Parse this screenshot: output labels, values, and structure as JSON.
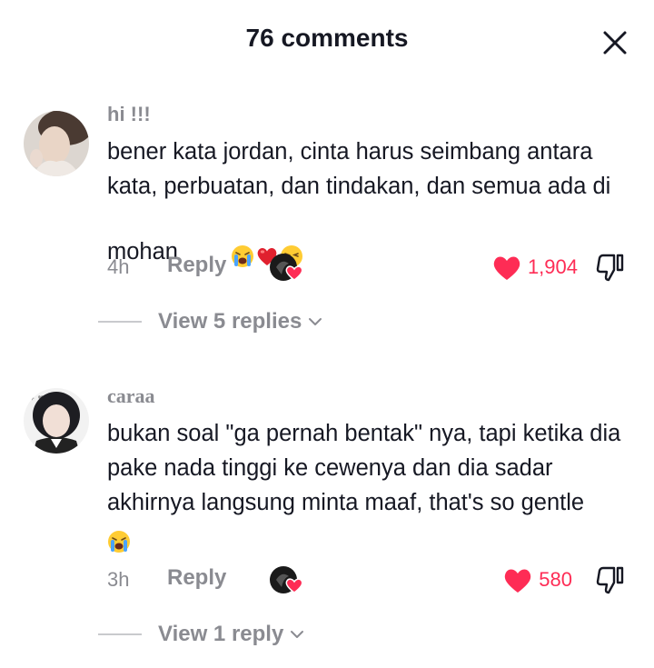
{
  "header": {
    "title": "76 comments",
    "close_icon": "close-icon"
  },
  "comments": [
    {
      "username": "hi !!!",
      "text": "bener kata jordan, cinta harus seimbang antara kata, perbuatan, dan tindakan, dan semua ada di mohan",
      "emojis": [
        "loudly-crying-face-emoji",
        "red-heart-emoji",
        "weary-face-emoji"
      ],
      "time": "4h",
      "reply_label": "Reply",
      "likes": "1,904",
      "liked": true,
      "view_replies": "View 5 replies"
    },
    {
      "username": "caraa",
      "text": "bukan soal \"ga pernah bentak\" nya, tapi ketika dia pake nada tinggi ke cewenya dan dia sadar akhirnya langsung minta maaf, that's so gentle",
      "emojis": [
        "loudly-crying-face-emoji"
      ],
      "time": "3h",
      "reply_label": "Reply",
      "likes": "580",
      "liked": true,
      "view_replies": "View 1 reply"
    }
  ],
  "colors": {
    "like_red": "#fe2c55",
    "muted_gray": "#8a8b91",
    "text_dark": "#161823"
  }
}
